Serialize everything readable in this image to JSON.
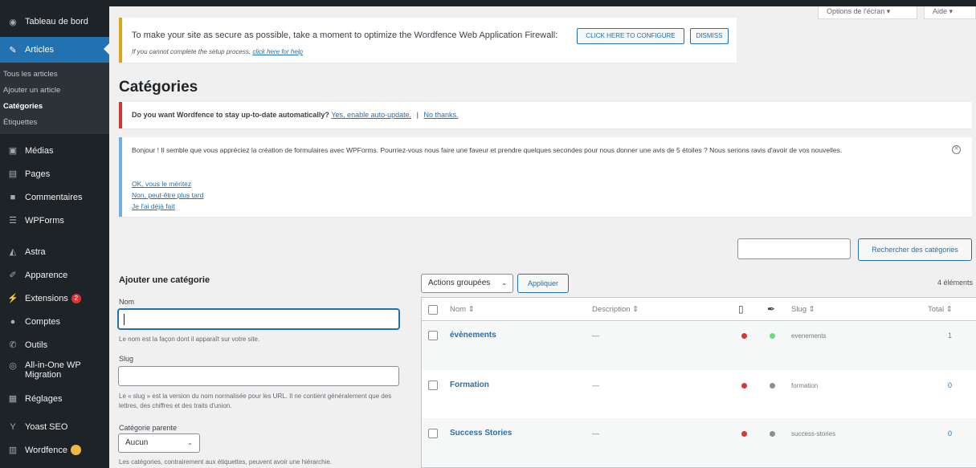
{
  "sidebar": {
    "dashboard": "Tableau de bord",
    "articles": "Articles",
    "submenu": [
      "Tous les articles",
      "Ajouter un article",
      "Catégories",
      "Étiquettes"
    ],
    "items": [
      "Médias",
      "Pages",
      "Commentaires",
      "WPForms",
      "Astra",
      "Apparence",
      "Extensions",
      "Comptes",
      "Outils",
      "All-in-One WP Migration",
      "Réglages",
      "Yoast SEO",
      "Wordfence"
    ],
    "extensions_badge": "2"
  },
  "screen": {
    "options": "Options de l'écran ▾",
    "help": "Aide ▾"
  },
  "wordfence_notice": {
    "message": "To make your site as secure as possible, take a moment to optimize the Wordfence Web Application Firewall:",
    "configure": "CLICK HERE TO CONFIGURE",
    "dismiss": "DISMISS",
    "sub_text": "If you cannot complete the setup process, ",
    "sub_link": "click here for help"
  },
  "page_title": "Catégories",
  "autoupdate_notice": {
    "question": "Do you want Wordfence to stay up-to-date automatically?",
    "yes": "Yes, enable auto-update.",
    "sep": "|",
    "no": "No thanks."
  },
  "wpforms_notice": {
    "message": "Bonjour ! Il semble que vous appréciez la création de formulaires avec WPForms. Pourriez-vous nous faire une faveur et prendre quelques secondes pour nous donner une avis de 5 étoiles ? Nous serions ravis d'avoir de vos nouvelles.",
    "link1": "OK, vous le méritez",
    "link2": "Non, peut-être plus tard",
    "link3": "Je l'ai déjà fait"
  },
  "search": {
    "value": "",
    "button": "Rechercher des catégories"
  },
  "add_form": {
    "title": "Ajouter une catégorie",
    "name_label": "Nom",
    "name_value": "",
    "name_help": "Le nom est la façon dont il apparaît sur votre site.",
    "slug_label": "Slug",
    "slug_value": "",
    "slug_help": "Le « slug » est la version du nom normalisée pour les URL. Il ne contient généralement que des lettres, des chiffres et des traits d'union.",
    "parent_label": "Catégorie parente",
    "parent_selected": "Aucun",
    "parent_help": "Les catégories, contrairement aux étiquettes, peuvent avoir une hiérarchie."
  },
  "table": {
    "bulk_actions": "Actions groupées",
    "apply": "Appliquer",
    "count": "4 éléments",
    "headers": {
      "name": "Nom ⇕",
      "description": "Description ⇕",
      "slug": "Slug ⇕",
      "total": "Total ⇕"
    },
    "rows": [
      {
        "name": "évènements",
        "description": "—",
        "slug": "evenements",
        "total": "1",
        "dot1": "#d63638",
        "dot2": "#68de7c"
      },
      {
        "name": "Formation",
        "description": "—",
        "slug": "formation",
        "total": "0",
        "dot1": "#d63638",
        "dot2": "#8c8f94"
      },
      {
        "name": "Success Stories",
        "description": "—",
        "slug": "success-stories",
        "total": "0",
        "dot1": "#d63638",
        "dot2": "#8c8f94"
      }
    ]
  },
  "colors": {
    "accent": "#2271b1",
    "sidebar": "#1d2327",
    "warning": "#dba617",
    "error": "#d63638",
    "info": "#72aee6"
  }
}
